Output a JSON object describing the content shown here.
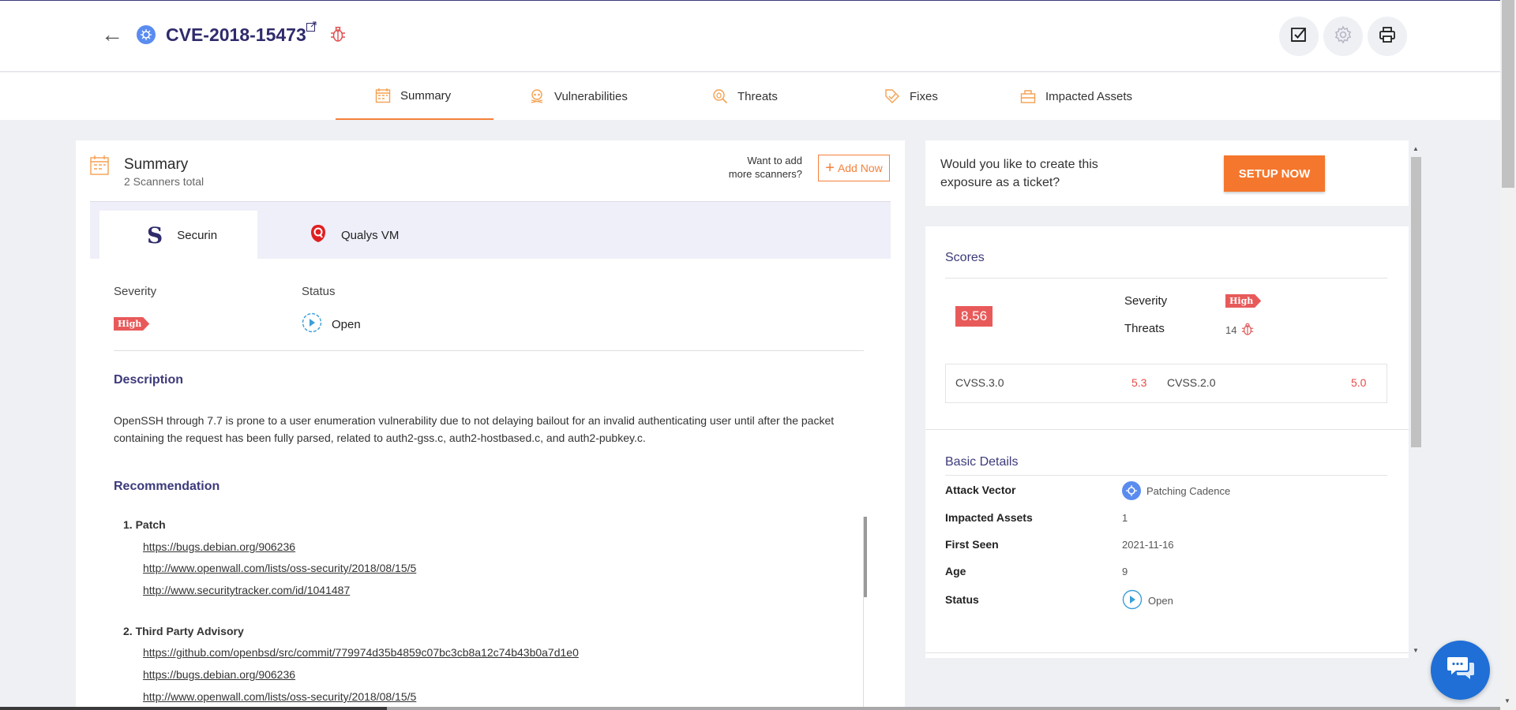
{
  "header": {
    "back_icon": "arrow-left-icon",
    "title": "CVE-2018-15473",
    "external_link_icon": "external-link-icon",
    "bug_icon": "bug-icon",
    "actions": [
      {
        "name": "checklist-icon"
      },
      {
        "name": "gear-icon"
      },
      {
        "name": "print-icon"
      }
    ]
  },
  "tabs": [
    {
      "label": "Summary",
      "icon": "calendar-icon",
      "active": true
    },
    {
      "label": "Vulnerabilities",
      "icon": "skull-icon",
      "active": false
    },
    {
      "label": "Threats",
      "icon": "search-bug-icon",
      "active": false
    },
    {
      "label": "Fixes",
      "icon": "tag-check-icon",
      "active": false
    },
    {
      "label": "Impacted Assets",
      "icon": "asset-icon",
      "active": false
    }
  ],
  "summary": {
    "title": "Summary",
    "subtitle": "2 Scanners total",
    "want_more_line1": "Want to add",
    "want_more_line2": "more scanners?",
    "add_button": "Add Now",
    "scanners": [
      {
        "label": "Securin",
        "logo_letter": "S"
      },
      {
        "label": "Qualys VM"
      }
    ],
    "severity_label": "Severity",
    "severity_value": "High",
    "status_label": "Status",
    "status_value": "Open",
    "description_heading": "Description",
    "description": "OpenSSH through 7.7 is prone to a user enumeration vulnerability due to not delaying bailout for an invalid authenticating user until after the packet containing the request has been fully parsed, related to auth2-gss.c, auth2-hostbased.c, and auth2-pubkey.c.",
    "recommendation_heading": "Recommendation",
    "recommendations": [
      {
        "title": "1. Patch",
        "links": [
          "https://bugs.debian.org/906236",
          "http://www.openwall.com/lists/oss-security/2018/08/15/5",
          "http://www.securitytracker.com/id/1041487"
        ]
      },
      {
        "title": "2. Third Party Advisory",
        "links": [
          "https://github.com/openbsd/src/commit/779974d35b4859c07bc3cb8a12c74b43b0a7d1e0",
          "https://bugs.debian.org/906236",
          "http://www.openwall.com/lists/oss-security/2018/08/15/5"
        ]
      }
    ]
  },
  "ticket": {
    "text": "Would you like to create this exposure as a ticket?",
    "button": "SETUP NOW"
  },
  "scores": {
    "heading": "Scores",
    "score": "8.56",
    "severity_label": "Severity",
    "severity_value": "High",
    "threats_label": "Threats",
    "threats_value": "14",
    "cvss3_label": "CVSS.3.0",
    "cvss3_value": "5.3",
    "cvss2_label": "CVSS.2.0",
    "cvss2_value": "5.0"
  },
  "basic_details": {
    "heading": "Basic Details",
    "rows": [
      {
        "key": "Attack Vector",
        "value": "Patching Cadence"
      },
      {
        "key": "Impacted Assets",
        "value": "1"
      },
      {
        "key": "First Seen",
        "value": "2021-11-16"
      },
      {
        "key": "Age",
        "value": "9"
      },
      {
        "key": "Status",
        "value": "Open"
      }
    ]
  },
  "colors": {
    "accent": "#f5813c",
    "brand": "#2f2b6b",
    "severity_high": "#e85a5a",
    "chat": "#1f6fd6"
  }
}
